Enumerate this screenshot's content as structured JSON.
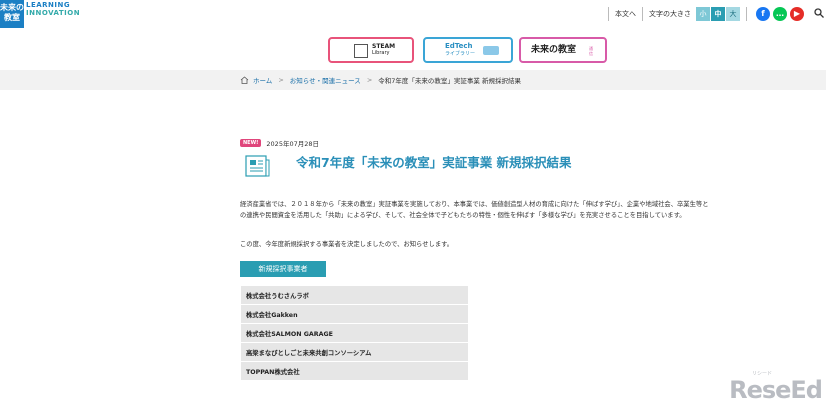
{
  "header": {
    "logo": {
      "line1": "未来の",
      "line2": "教室",
      "text1": "LEARNING",
      "text2": "INNOVATION"
    },
    "body_text_link": "本文へ",
    "font_size_label": "文字の大きさ",
    "font_sizes": [
      "小",
      "中",
      "大"
    ],
    "sns": [
      "f",
      "…",
      "▶"
    ],
    "search_icon": "search-icon"
  },
  "banners": {
    "steam": {
      "line1": "STEAM",
      "line2": "Library"
    },
    "edtech": {
      "line1": "EdTech",
      "line2": "ライブラリー"
    },
    "mirai": {
      "title": "未来の教室",
      "sub": "通信"
    }
  },
  "breadcrumb": {
    "home": "ホーム",
    "news": "お知らせ・関連ニュース",
    "current": "令和7年度「未来の教室」実証事業 新規採択結果",
    "separator": ">"
  },
  "article": {
    "badge": "NEW!",
    "date": "2025年07月28日",
    "title": "令和7年度「未来の教室」実証事業 新規採択結果",
    "paragraph1": "経済産業省では、２０１８年から「未来の教室」実証事業を実施しており、本事業では、価値創造型人材の育成に向けた「伸ばす学び」、企業や地域社会、卒業生等との連携や民間資金を活用した「共助」による学び、そして、社会全体で子どもたちの特性・個性を伸ばす「多様な学び」を充実させることを目指しています。",
    "paragraph2": "この度、今年度新規採択する事業者を決定しましたので、お知らせします。",
    "section_title": "新規採択事業者",
    "companies": [
      "株式会社うむさんラボ",
      "株式会社Gakken",
      "株式会社SALMON GARAGE",
      "高梁まなびとしごと未来共創コンソーシアム",
      "TOPPAN株式会社"
    ]
  },
  "watermark": {
    "main": "ReseEd",
    "sub": "リシード"
  },
  "colors": {
    "accent": "#2a9db2",
    "title": "#2a8fb8",
    "badge": "#e0457b"
  }
}
